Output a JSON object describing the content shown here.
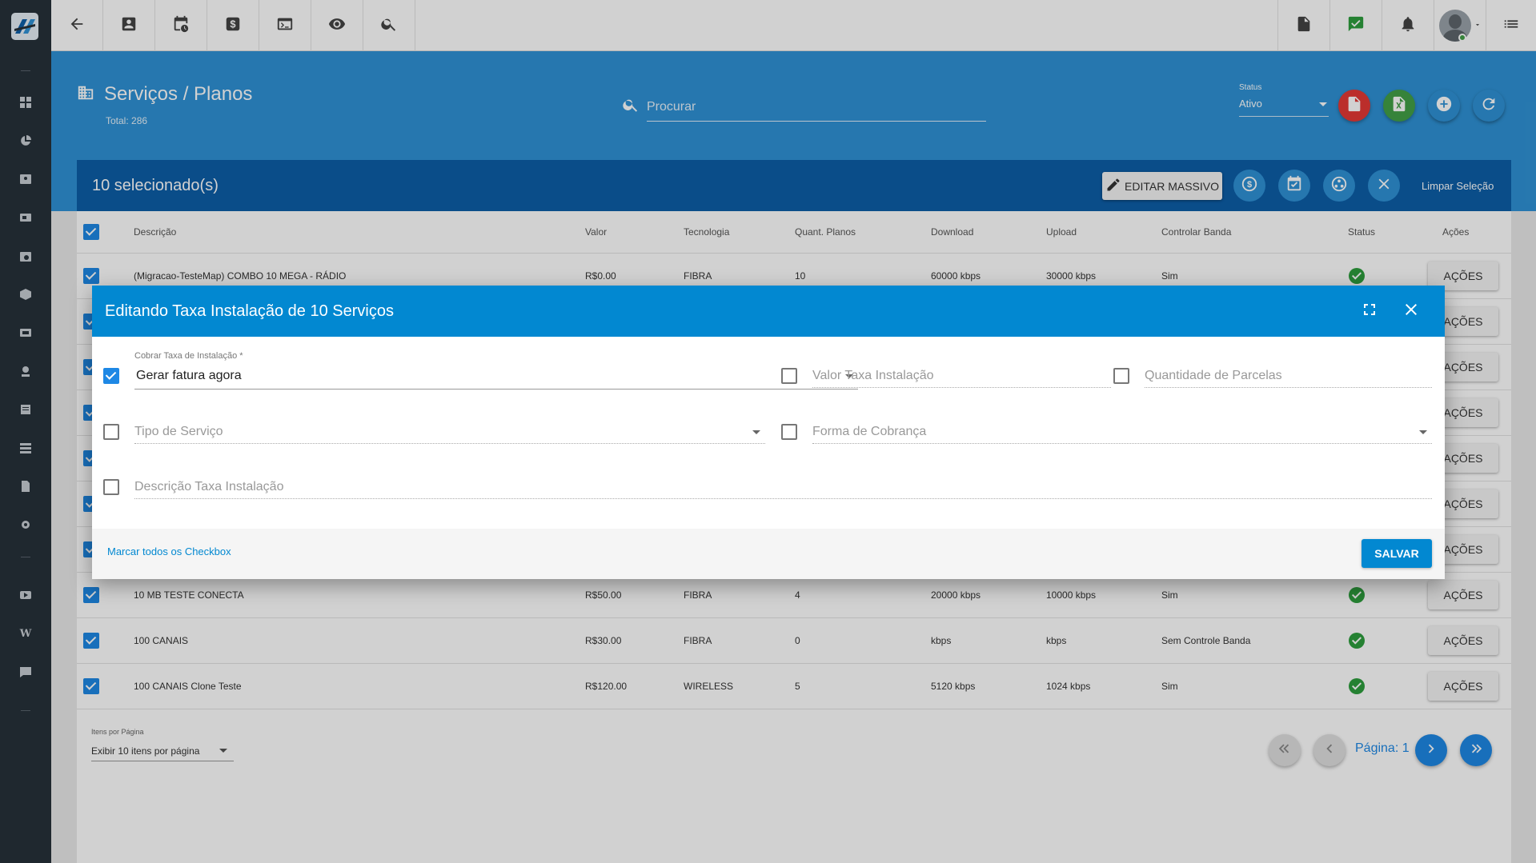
{
  "topbar": {
    "buttons": [
      "back-arrow-icon",
      "contact-card-icon",
      "calendar-clock-icon",
      "dollar-icon",
      "terminal-icon",
      "eye-icon",
      "search-icon"
    ],
    "right_buttons": [
      "pdf-icon",
      "chat-check-icon",
      "bell-icon",
      "avatar",
      "list-menu-icon"
    ]
  },
  "header": {
    "title": "Serviços / Planos",
    "total": "Total: 286",
    "search_placeholder": "Procurar",
    "status_label": "Status",
    "status_value": "Ativo"
  },
  "selection": {
    "count": "10 selecionado(s)",
    "edit_mass": "EDITAR MASSIVO",
    "clear": "Limpar Seleção"
  },
  "table": {
    "headers": [
      "Descrição",
      "Valor",
      "Tecnologia",
      "Quant. Planos",
      "Download",
      "Upload",
      "Controlar Banda",
      "Status",
      "Ações"
    ],
    "rows": [
      {
        "descricao": "(Migracao-TesteMap) COMBO 10 MEGA - RÁDIO",
        "valor": "R$0.00",
        "tecnologia": "FIBRA",
        "quant": "10",
        "download": "60000 kbps",
        "upload": "30000 kbps",
        "controlar": "Sim",
        "acoes": "AÇÕES"
      },
      {
        "descricao": "",
        "valor": "",
        "tecnologia": "",
        "quant": "",
        "download": "",
        "upload": "",
        "controlar": "",
        "acoes": "AÇÕES"
      },
      {
        "descricao": "",
        "valor": "",
        "tecnologia": "",
        "quant": "",
        "download": "",
        "upload": "",
        "controlar": "",
        "acoes": "AÇÕES"
      },
      {
        "descricao": "",
        "valor": "",
        "tecnologia": "",
        "quant": "",
        "download": "",
        "upload": "",
        "controlar": "",
        "acoes": "AÇÕES"
      },
      {
        "descricao": "",
        "valor": "",
        "tecnologia": "",
        "quant": "",
        "download": "",
        "upload": "",
        "controlar": "",
        "acoes": "AÇÕES"
      },
      {
        "descricao": "",
        "valor": "",
        "tecnologia": "",
        "quant": "",
        "download": "",
        "upload": "",
        "controlar": "",
        "acoes": "AÇÕES"
      },
      {
        "descricao": "",
        "valor": "",
        "tecnologia": "",
        "quant": "",
        "download": "",
        "upload": "",
        "controlar": "",
        "acoes": "AÇÕES"
      },
      {
        "descricao": "10 MB TESTE CONECTA",
        "valor": "R$50.00",
        "tecnologia": "FIBRA",
        "quant": "4",
        "download": "20000 kbps",
        "upload": "10000 kbps",
        "controlar": "Sim",
        "acoes": "AÇÕES"
      },
      {
        "descricao": "100 CANAIS",
        "valor": "R$30.00",
        "tecnologia": "FIBRA",
        "quant": "0",
        "download": "kbps",
        "upload": "kbps",
        "controlar": "Sem Controle Banda",
        "acoes": "AÇÕES"
      },
      {
        "descricao": "100 CANAIS Clone Teste",
        "valor": "R$120.00",
        "tecnologia": "WIRELESS",
        "quant": "5",
        "download": "5120 kbps",
        "upload": "1024 kbps",
        "controlar": "Sim",
        "acoes": "AÇÕES"
      }
    ]
  },
  "pagination": {
    "ipp_label": "Itens por Página",
    "ipp_value": "Exibir 10 itens por página",
    "page_label": "Página: 1"
  },
  "modal": {
    "title": "Editando Taxa Instalação de 10 Serviços",
    "cobrar_label": "Cobrar Taxa de Instalação *",
    "cobrar_value": "Gerar fatura agora",
    "valor_placeholder": "Valor Taxa Instalação",
    "parcelas_placeholder": "Quantidade de Parcelas",
    "tipo_placeholder": "Tipo de Serviço",
    "forma_placeholder": "Forma de Cobrança",
    "descricao_placeholder": "Descrição Taxa Instalação",
    "mark_all": "Marcar todos os Checkbox",
    "save": "SALVAR"
  },
  "colors": {
    "header_blue": "#2f92d6",
    "selection_blue": "#0d5ea8",
    "modal_blue": "#0288d1",
    "sidebar": "#27313a",
    "status_green": "#2e9e3e"
  }
}
